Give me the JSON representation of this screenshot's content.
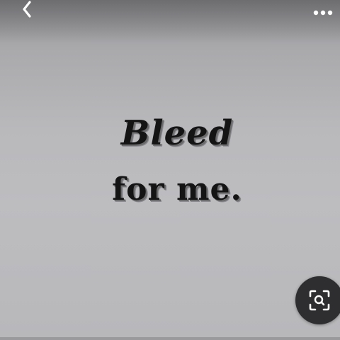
{
  "toolbar": {
    "back_icon": "chevron-left-icon",
    "more_icon": "more-horizontal-icon"
  },
  "pin": {
    "text_line1": "Bleed",
    "text_line2": "for me."
  },
  "fab": {
    "icon": "visual-search-icon"
  },
  "colors": {
    "background": "#bdbdc0",
    "text": "#141414",
    "fab": "#2e2e30",
    "icon": "#ffffff"
  }
}
